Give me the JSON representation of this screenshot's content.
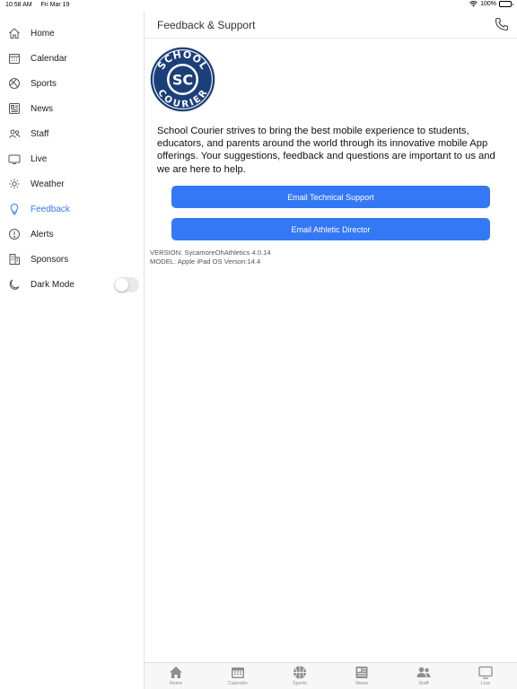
{
  "status_bar": {
    "time": "10:58 AM",
    "date": "Fri Mar 19",
    "battery": "100%"
  },
  "sidebar": {
    "items": [
      {
        "label": "Home",
        "icon": "home-icon"
      },
      {
        "label": "Calendar",
        "icon": "calendar-icon"
      },
      {
        "label": "Sports",
        "icon": "ball-icon"
      },
      {
        "label": "News",
        "icon": "newspaper-icon"
      },
      {
        "label": "Staff",
        "icon": "people-icon"
      },
      {
        "label": "Live",
        "icon": "tv-icon"
      },
      {
        "label": "Weather",
        "icon": "sun-icon"
      },
      {
        "label": "Feedback",
        "icon": "lightbulb-icon",
        "active": true
      },
      {
        "label": "Alerts",
        "icon": "alert-icon"
      },
      {
        "label": "Sponsors",
        "icon": "building-icon"
      },
      {
        "label": "Dark Mode",
        "icon": "moon-icon",
        "toggle": false
      }
    ]
  },
  "header": {
    "title": "Feedback & Support"
  },
  "logo": {
    "top_text": "SCHOOL",
    "initials": "SC",
    "bottom_text": "COURIER"
  },
  "main": {
    "description": "School Courier strives to bring the best mobile experience to students, educators, and parents around the world through its innovative mobile App offerings. Your suggestions, feedback and questions are important to us and we are here to help.",
    "email_tech_label": "Email Technical Support",
    "email_athletic_label": "Email Athletic Director",
    "version": "VERSION: SycamoreOhAthletics 4.0.14",
    "model": "MODEL: Apple iPad OS Verson:14.4"
  },
  "tabbar": {
    "tabs": [
      {
        "label": "Home"
      },
      {
        "label": "Calender"
      },
      {
        "label": "Sports"
      },
      {
        "label": "News"
      },
      {
        "label": "Staff"
      },
      {
        "label": "Live"
      }
    ]
  },
  "colors": {
    "accent": "#3478f6",
    "logo_navy": "#1c3f7a",
    "tab_icon": "#8e8e93"
  }
}
